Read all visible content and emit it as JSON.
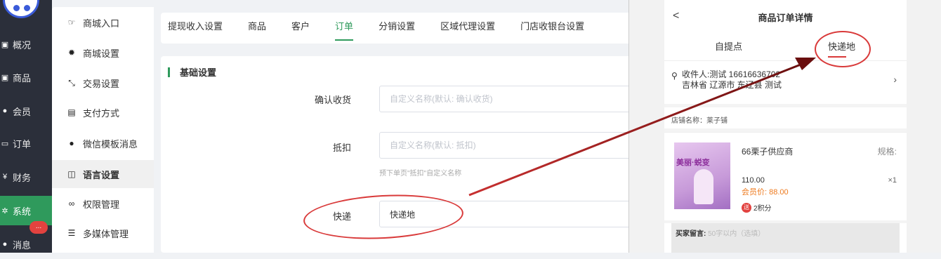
{
  "nav": {
    "items": [
      {
        "label": "概况",
        "icon": "chart-icon"
      },
      {
        "label": "商品",
        "icon": "box-icon"
      },
      {
        "label": "会员",
        "icon": "users-icon"
      },
      {
        "label": "订单",
        "icon": "cart-icon"
      },
      {
        "label": "财务",
        "icon": "yen-icon",
        "glyph": "¥"
      },
      {
        "label": "系统",
        "icon": "settings-icon"
      },
      {
        "label": "消息",
        "icon": "chat-icon"
      }
    ],
    "badge": "..."
  },
  "submenu": {
    "items": [
      {
        "label": "商城入口",
        "icon": "hand-pointer-icon"
      },
      {
        "label": "商城设置",
        "icon": "gear-icon"
      },
      {
        "label": "交易设置",
        "icon": "exchange-icon"
      },
      {
        "label": "支付方式",
        "icon": "card-icon"
      },
      {
        "label": "微信模板消息",
        "icon": "wechat-icon"
      },
      {
        "label": "语言设置",
        "icon": "language-icon"
      },
      {
        "label": "权限管理",
        "icon": "key-icon"
      },
      {
        "label": "多媒体管理",
        "icon": "list-icon"
      }
    ]
  },
  "tabs": [
    "提现收入设置",
    "商品",
    "客户",
    "订单",
    "分销设置",
    "区域代理设置",
    "门店收银台设置"
  ],
  "main": {
    "section_title": "基础设置",
    "fields": [
      {
        "label": "确认收货",
        "placeholder": "自定义名称(默认: 确认收货)",
        "value": ""
      },
      {
        "label": "抵扣",
        "placeholder": "自定义名称(默认: 抵扣)",
        "value": "",
        "hint": "预下单页\"抵扣\"自定义名称"
      },
      {
        "label": "快递",
        "placeholder": "",
        "value": "快递地"
      }
    ]
  },
  "phone": {
    "back": "<",
    "title": "商品订单详情",
    "tabs": [
      "自提点",
      "快递地"
    ],
    "address": {
      "line1": "收件人:测试 16616636702",
      "line2": "吉林省 辽源市 东辽县 测试",
      "chevron": "›"
    },
    "store": "店铺名称：莱子铺",
    "product": {
      "name": "66栗子供应商",
      "spec": "规格:",
      "price": "110.00",
      "member_price": "会员价: 88.00",
      "qty": "×1",
      "points_badge": "送",
      "points": "2积分",
      "thumb_text": "美丽·蜕变"
    },
    "note": {
      "label": "买家留言:",
      "placeholder": "50字以内（选填）"
    }
  },
  "colors": {
    "accent": "#2f9a5c",
    "annotation": "#d93a3a",
    "arrow": "#7a1414",
    "member": "#ee7a1e"
  }
}
